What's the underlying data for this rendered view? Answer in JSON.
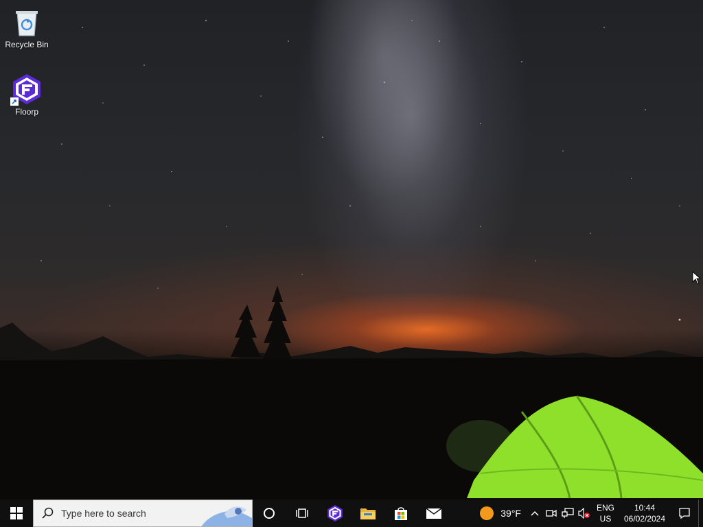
{
  "desktop": {
    "icons": [
      {
        "label": "Recycle Bin",
        "icon": "recycle-bin-icon"
      },
      {
        "label": "Floorp",
        "icon": "floorp-icon"
      }
    ]
  },
  "taskbar": {
    "search": {
      "placeholder": "Type here to search"
    },
    "pinned": [
      {
        "name": "cortana",
        "icon": "cortana-circle-icon"
      },
      {
        "name": "task-view",
        "icon": "task-view-icon"
      },
      {
        "name": "floorp",
        "icon": "floorp-icon"
      },
      {
        "name": "file-explorer",
        "icon": "folder-icon"
      },
      {
        "name": "microsoft-store",
        "icon": "store-bag-icon"
      },
      {
        "name": "mail",
        "icon": "mail-icon"
      }
    ],
    "weather": {
      "temperature": "39°F",
      "icon": "sun-icon"
    },
    "tray": {
      "language_line1": "ENG",
      "language_line2": "US",
      "time": "10:44",
      "date": "06/02/2024"
    }
  },
  "colors": {
    "taskbar_bg": "#101010",
    "search_bg": "#f2f2f2",
    "floorp_purple": "#5b2bd6",
    "weather_sun": "#f39a1d",
    "tent_green": "#8fe02a"
  }
}
